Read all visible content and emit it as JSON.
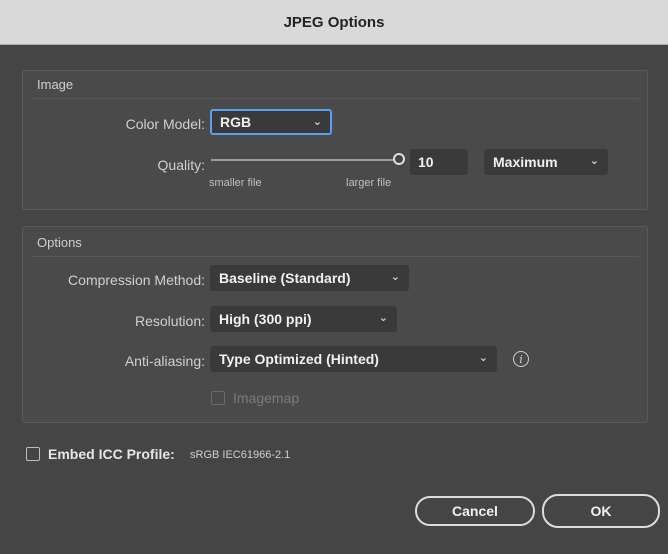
{
  "dialog": {
    "title": "JPEG Options"
  },
  "image_group": {
    "title": "Image",
    "color_model_label": "Color Model:",
    "color_model_value": "RGB",
    "quality_label": "Quality:",
    "quality_value": "10",
    "quality_level": 1.0,
    "quality_preset": "Maximum",
    "smaller_file_label": "smaller file",
    "larger_file_label": "larger file"
  },
  "options_group": {
    "title": "Options",
    "compression_label": "Compression Method:",
    "compression_value": "Baseline (Standard)",
    "resolution_label": "Resolution:",
    "resolution_value": "High (300 ppi)",
    "antialiasing_label": "Anti-aliasing:",
    "antialiasing_value": "Type Optimized (Hinted)",
    "imagemap_label": "Imagemap",
    "imagemap_checked": false,
    "imagemap_enabled": false
  },
  "embed_icc": {
    "label": "Embed ICC Profile:",
    "profile": "sRGB IEC61966-2.1",
    "checked": false
  },
  "buttons": {
    "cancel": "Cancel",
    "ok": "OK"
  },
  "icons": {
    "dropdown": "chevron-down-icon",
    "info": "info-icon",
    "slider_knob": "slider-knob"
  },
  "colors": {
    "focus_ring": "#5aa0f0",
    "dialog_bg": "#454545",
    "titlebar_bg": "#d9d9d9"
  }
}
